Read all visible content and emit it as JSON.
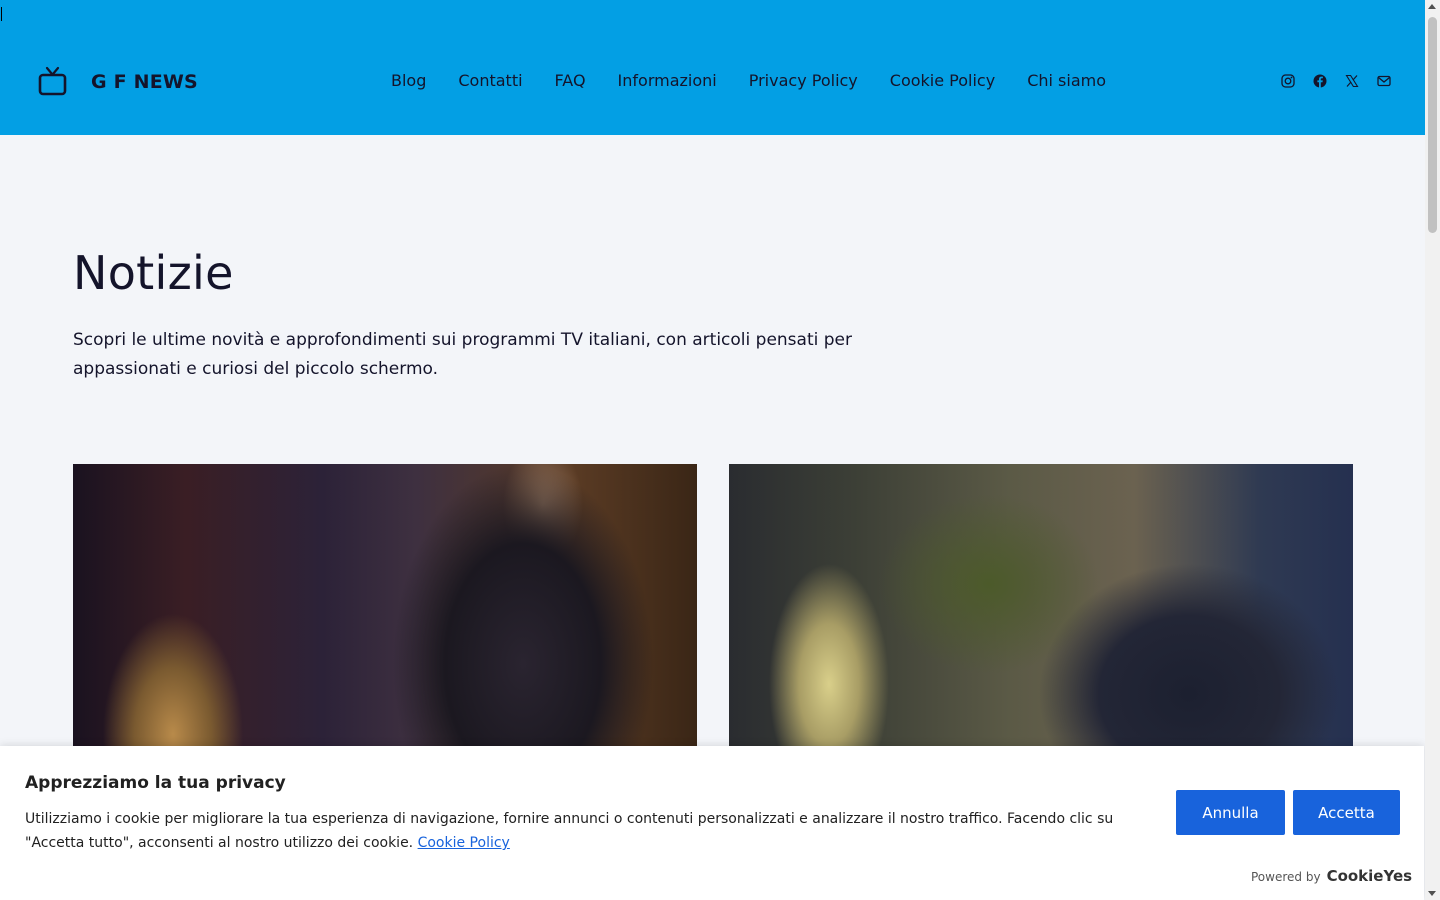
{
  "header": {
    "logo_text": "G F NEWS",
    "logo_icon": "tv-icon",
    "nav": [
      {
        "label": "Blog"
      },
      {
        "label": "Contatti"
      },
      {
        "label": "FAQ"
      },
      {
        "label": "Informazioni"
      },
      {
        "label": "Privacy Policy"
      },
      {
        "label": "Cookie Policy"
      },
      {
        "label": "Chi siamo"
      }
    ],
    "social_icons": [
      "instagram-icon",
      "facebook-icon",
      "x-icon",
      "mail-icon"
    ]
  },
  "main": {
    "title": "Notizie",
    "subtitle": "Scopri le ultime novità e approfondimenti sui programmi TV italiani, con articoli pensati per appassionati e curiosi del piccolo schermo."
  },
  "cookie_banner": {
    "title": "Apprezziamo la tua privacy",
    "text": "Utilizziamo i cookie per migliorare la tua esperienza di navigazione, fornire annunci o contenuti personalizzati e analizzare il nostro traffico. Facendo clic su \"Accetta tutto\", acconsenti al nostro utilizzo dei cookie.",
    "link_label": "Cookie Policy",
    "reject_label": "Annulla",
    "accept_label": "Accetta",
    "powered_by": "Powered by",
    "brand": "CookieYes"
  },
  "colors": {
    "header_bg": "#039fe4",
    "page_bg": "#f3f5f9",
    "button_bg": "#1863dc",
    "text": "#14142b"
  }
}
